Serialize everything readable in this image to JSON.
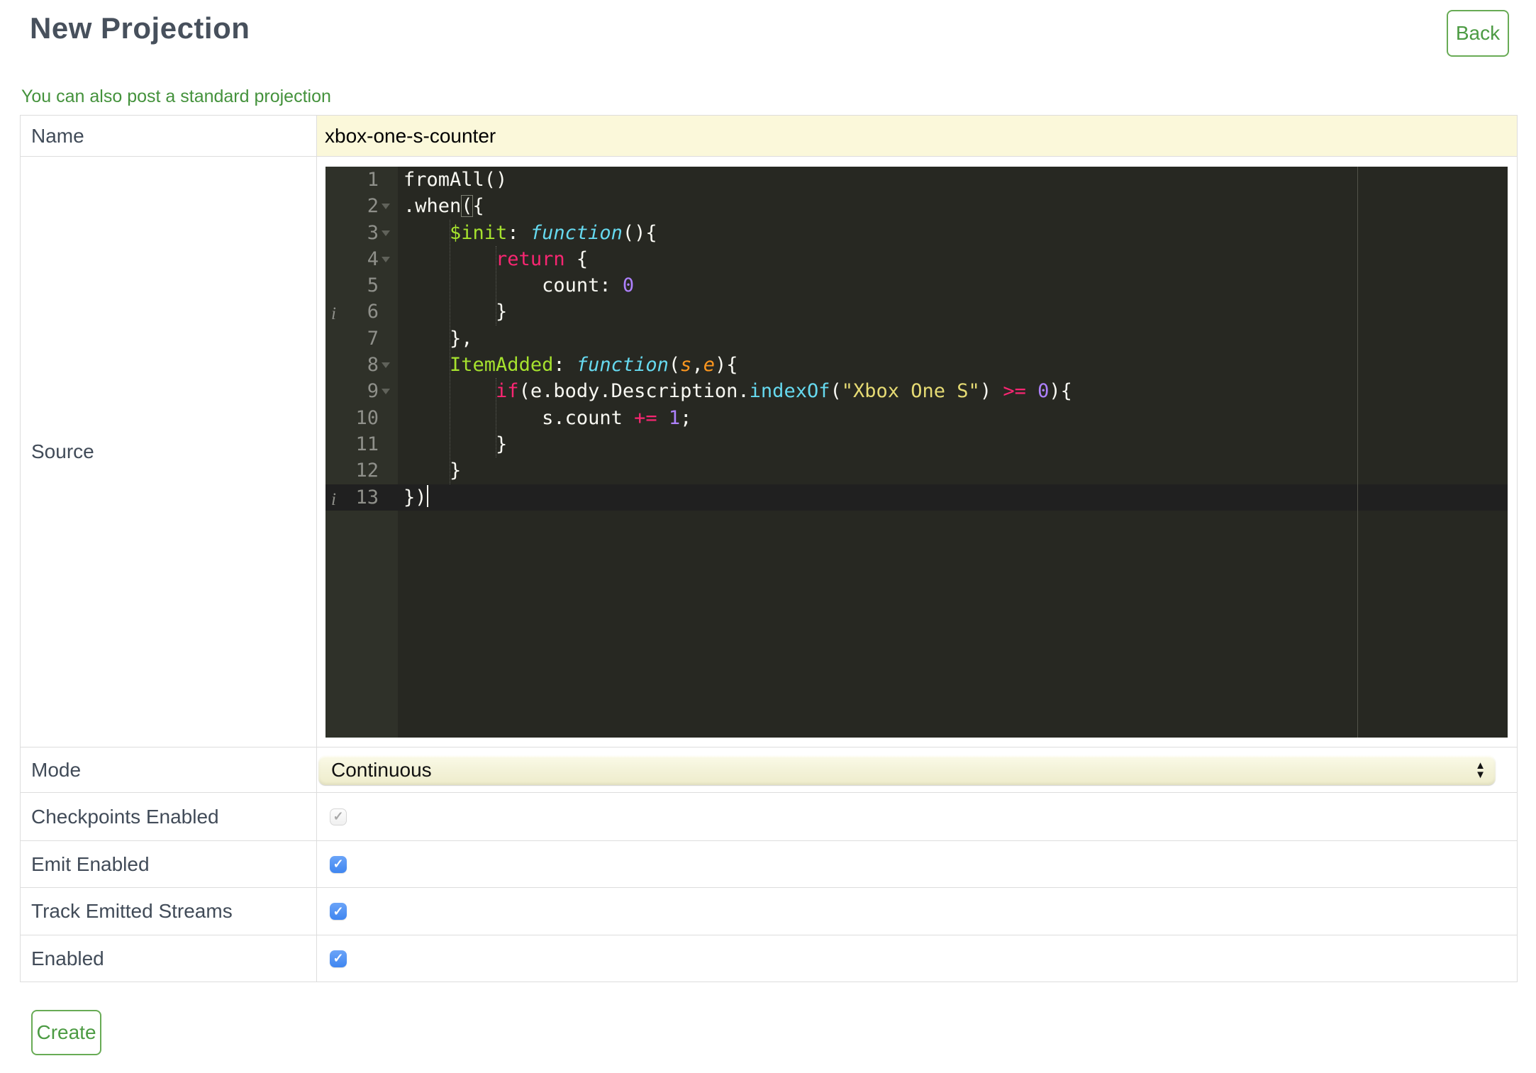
{
  "page": {
    "title": "New Projection",
    "back_label": "Back",
    "link_text": "You can also post a standard projection",
    "create_label": "Create"
  },
  "colors": {
    "accent_green": "#4c9b43",
    "label_text": "#414b58",
    "row_border": "#dddddd",
    "input_yellow": "#fbf8da",
    "checkbox_blue": "#4490f2"
  },
  "icons": {
    "check": "✓",
    "select_up": "▲",
    "select_down": "▼",
    "annotation_info": "i"
  },
  "form": {
    "name": {
      "label": "Name",
      "value": "xbox-one-s-counter"
    },
    "source": {
      "label": "Source"
    },
    "mode": {
      "label": "Mode",
      "value": "Continuous"
    },
    "checkboxes": [
      {
        "label": "Checkpoints Enabled",
        "checked": true,
        "disabled": true
      },
      {
        "label": "Emit Enabled",
        "checked": true,
        "disabled": false
      },
      {
        "label": "Track Emitted Streams",
        "checked": true,
        "disabled": false
      },
      {
        "label": "Enabled",
        "checked": true,
        "disabled": false
      }
    ]
  },
  "editor": {
    "theme": {
      "background": "#272822",
      "gutter": "#2f3129",
      "text": "#f8f8f2",
      "keyword": "#f92672",
      "string": "#e6db74",
      "number": "#ae81ff",
      "function_name": "#a6e22e",
      "storage_type": "#66d9ef",
      "argument": "#fd971f",
      "active_line": "#202020"
    },
    "lines": [
      {
        "n": 1,
        "segments": [
          [
            "p",
            "fromAll()"
          ]
        ]
      },
      {
        "n": 2,
        "fold": true,
        "segments": [
          [
            "p",
            ".when"
          ],
          [
            "bm",
            "("
          ],
          [
            "p",
            "{"
          ]
        ]
      },
      {
        "n": 3,
        "fold": true,
        "segments": [
          [
            "p",
            "    "
          ],
          [
            "g",
            "$init"
          ],
          [
            "p",
            ": "
          ],
          [
            "ci",
            "function"
          ],
          [
            "p",
            "(){"
          ]
        ]
      },
      {
        "n": 4,
        "fold": true,
        "segments": [
          [
            "p",
            "        "
          ],
          [
            "k",
            "return"
          ],
          [
            "p",
            " {"
          ]
        ]
      },
      {
        "n": 5,
        "segments": [
          [
            "p",
            "            count: "
          ],
          [
            "n2",
            "0"
          ]
        ]
      },
      {
        "n": 6,
        "ann": true,
        "segments": [
          [
            "p",
            "        }"
          ]
        ]
      },
      {
        "n": 7,
        "segments": [
          [
            "p",
            "    },"
          ]
        ]
      },
      {
        "n": 8,
        "fold": true,
        "segments": [
          [
            "p",
            "    "
          ],
          [
            "g",
            "ItemAdded"
          ],
          [
            "p",
            ": "
          ],
          [
            "ci",
            "function"
          ],
          [
            "p",
            "("
          ],
          [
            "a",
            "s"
          ],
          [
            "p",
            ","
          ],
          [
            "a",
            "e"
          ],
          [
            "p",
            "){"
          ]
        ]
      },
      {
        "n": 9,
        "fold": true,
        "segments": [
          [
            "p",
            "        "
          ],
          [
            "k",
            "if"
          ],
          [
            "p",
            "(e.body.Description."
          ],
          [
            "c",
            "indexOf"
          ],
          [
            "p",
            "("
          ],
          [
            "s",
            "\"Xbox One S\""
          ],
          [
            "p",
            ") "
          ],
          [
            "k",
            ">="
          ],
          [
            "p",
            " "
          ],
          [
            "n2",
            "0"
          ],
          [
            "p",
            "){"
          ]
        ]
      },
      {
        "n": 10,
        "segments": [
          [
            "p",
            "            s.count "
          ],
          [
            "k",
            "+="
          ],
          [
            "p",
            " "
          ],
          [
            "n2",
            "1"
          ],
          [
            "p",
            ";"
          ]
        ]
      },
      {
        "n": 11,
        "segments": [
          [
            "p",
            "        }"
          ]
        ]
      },
      {
        "n": 12,
        "segments": [
          [
            "p",
            "    }"
          ]
        ]
      },
      {
        "n": 13,
        "ann": true,
        "active": true,
        "cursor": true,
        "segments": [
          [
            "p",
            "})"
          ]
        ]
      }
    ]
  }
}
